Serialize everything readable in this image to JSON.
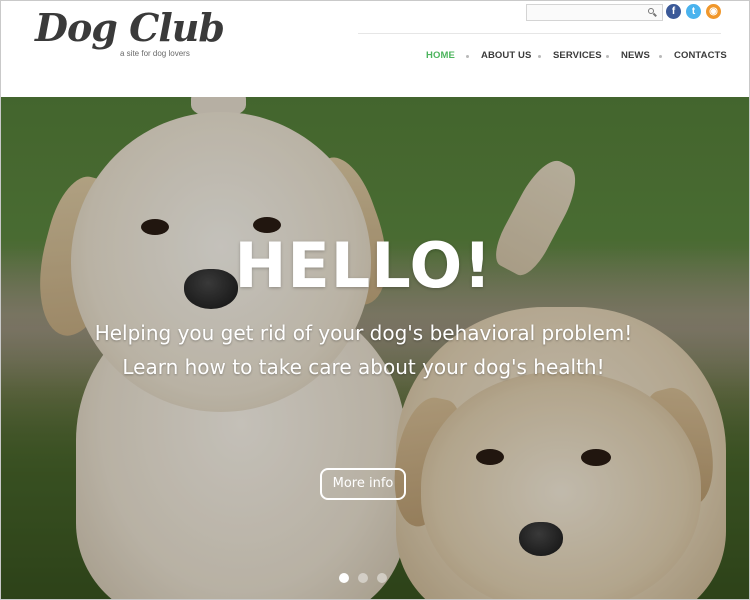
{
  "header": {
    "logo_title": "Dog Club",
    "logo_tagline": "a site for dog lovers",
    "search": {
      "value": "",
      "placeholder": ""
    },
    "social": [
      {
        "name": "facebook-icon",
        "glyph": "f",
        "color": "#3b5998"
      },
      {
        "name": "twitter-icon",
        "glyph": "t",
        "color": "#4ab3ee"
      },
      {
        "name": "rss-icon",
        "glyph": "◉",
        "color": "#f0972b"
      }
    ],
    "nav": {
      "items": [
        {
          "label": "HOME",
          "active": true
        },
        {
          "label": "ABOUT US",
          "active": false
        },
        {
          "label": "SERVICES",
          "active": false
        },
        {
          "label": "NEWS",
          "active": false
        },
        {
          "label": "CONTACTS",
          "active": false
        }
      ]
    }
  },
  "hero": {
    "title": "HELLO!",
    "line1": "Helping you get rid of your dog's behavioral problem!",
    "line2": "Learn how to take care about your dog's health!",
    "button_label": "More info",
    "slides": {
      "count": 3,
      "active_index": 0
    }
  },
  "colors": {
    "accent": "#4cb45d",
    "nav_text": "#3b3b3b",
    "logo_text": "#3a3a3a"
  }
}
